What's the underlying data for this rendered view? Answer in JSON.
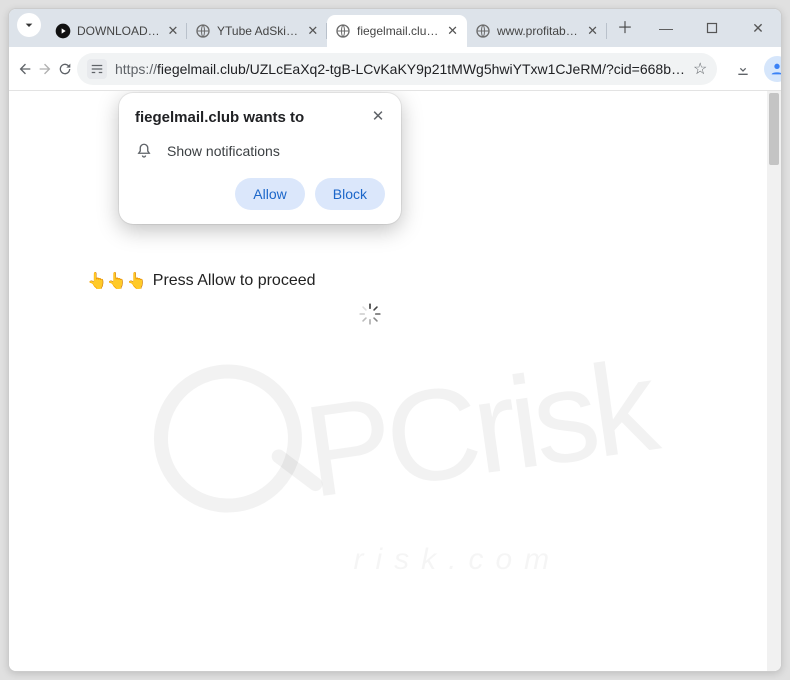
{
  "tabs": [
    {
      "label": "DOWNLOAD: P…",
      "favicon": "video"
    },
    {
      "label": "YTube AdSkipp…",
      "favicon": "globe"
    },
    {
      "label": "fiegelmail.club/…",
      "favicon": "globe",
      "active": true
    },
    {
      "label": "www.profitable…",
      "favicon": "globe"
    }
  ],
  "window_controls": {
    "min": "—",
    "max": "□",
    "close": "✕"
  },
  "address": {
    "scheme": "https://",
    "rest": "fiegelmail.club/UZLcEaXq2-tgB-LCvKaKY9p21tMWg5hwiYTxw1CJeRM/?cid=668b…"
  },
  "prompt": {
    "title": "fiegelmail.club wants to",
    "permission_label": "Show notifications",
    "allow": "Allow",
    "block": "Block"
  },
  "page": {
    "emoji": "👆👆👆",
    "message": " Press Allow to proceed"
  },
  "watermark": {
    "main": "PCrisk",
    "sub": "risk.com"
  }
}
